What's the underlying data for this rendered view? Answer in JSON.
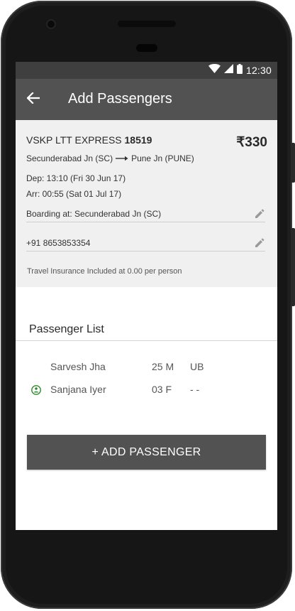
{
  "status_bar": {
    "time": "12:30",
    "icons": [
      "wifi-icon",
      "cell-signal-icon",
      "battery-icon"
    ]
  },
  "app_bar": {
    "title": "Add Passengers",
    "back_icon": "arrow-back-icon"
  },
  "journey": {
    "train_name": "VSKP LTT EXPRESS",
    "train_number": "18519",
    "fare": "₹330",
    "from_station": "Secunderabad Jn (SC)",
    "to_station": "Pune Jn (PUNE)",
    "departure": "Dep: 13:10 (Fri 30 Jun 17)",
    "arrival": "Arr: 00:55 (Sat 01 Jul 17)",
    "boarding": "Boarding at: Secunderabad Jn (SC)",
    "phone": "+91 8653853354",
    "insurance": "Travel Insurance Included at 0.00 per person"
  },
  "passenger_list": {
    "title": "Passenger List",
    "passengers": [
      {
        "name": "Sarvesh Jha",
        "age_gender": "25 M",
        "berth": "UB",
        "icon": ""
      },
      {
        "name": "Sanjana Iyer",
        "age_gender": "03 F",
        "berth": "- -",
        "icon": "senior-citizen-icon"
      }
    ]
  },
  "add_button": {
    "label": "+ ADD PASSENGER"
  },
  "colors": {
    "status_bar": "#3f3f3f",
    "app_bar": "#525252",
    "card_bg": "#f0f0f0",
    "button_bg": "#525252",
    "accent_green": "#2e8b2e"
  }
}
